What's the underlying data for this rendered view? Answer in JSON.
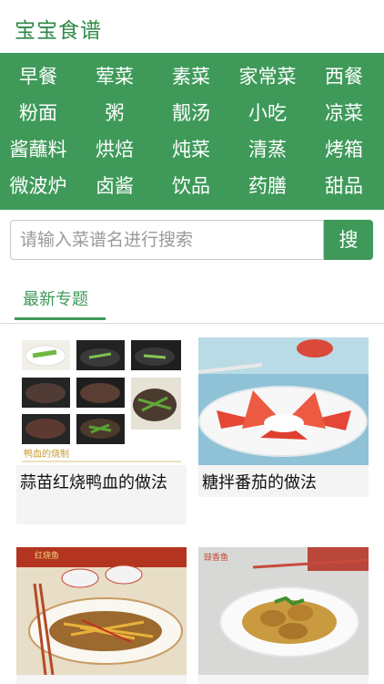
{
  "app": {
    "title": "宝宝食谱"
  },
  "categories": [
    [
      "早餐",
      "荤菜",
      "素菜",
      "家常菜",
      "西餐"
    ],
    [
      "粉面",
      "粥",
      "靓汤",
      "小吃",
      "凉菜"
    ],
    [
      "酱蘸料",
      "烘焙",
      "炖菜",
      "清蒸",
      "烤箱"
    ],
    [
      "微波炉",
      "卤酱",
      "饮品",
      "药膳",
      "甜品"
    ]
  ],
  "search": {
    "placeholder": "请输入菜谱名进行搜索",
    "button": "搜"
  },
  "tabs": {
    "active": "最新专题"
  },
  "recipes": [
    {
      "title": "蒜苗红烧鸭血的做法",
      "image_caption": "鸭血的烧制"
    },
    {
      "title": "糖拌番茄的做法"
    },
    {
      "title": "",
      "image_caption": "红烧鱼"
    },
    {
      "title": "",
      "image_caption": "豉香鱼"
    }
  ],
  "colors": {
    "accent": "#3f9a5a",
    "title": "#2f8a4a"
  }
}
